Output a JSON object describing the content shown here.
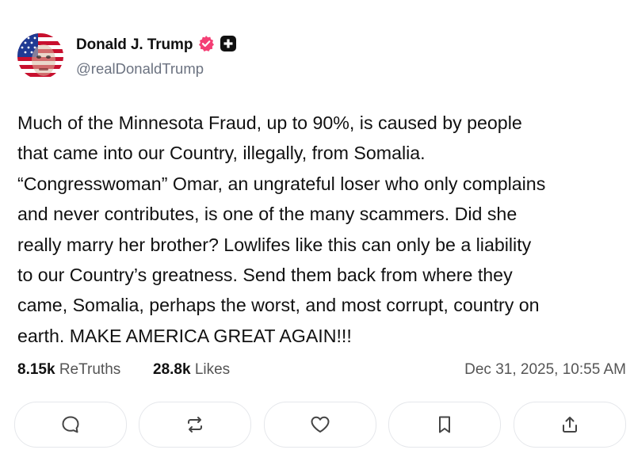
{
  "author": {
    "display_name": "Donald J. Trump",
    "handle": "@realDonaldTrump",
    "verified_badge_color": "#f43f75",
    "avatar_icon": "american-flag-portrait"
  },
  "post": {
    "text": "Much of the Minnesota Fraud, up to 90%, is caused by people\nthat came into our Country, illegally, from Somalia.\n“Congresswoman” Omar, an ungrateful loser who only complains\nand never contributes, is one of the many scammers. Did she\nreally marry her brother? Lowlifes like this can only be a liability\nto our Country’s greatness. Send them back from where they\ncame, Somalia, perhaps the worst, and most corrupt, country on\nearth. MAKE AMERICA GREAT AGAIN!!!"
  },
  "stats": {
    "retruths_count": "8.15k",
    "retruths_label": "ReTruths",
    "likes_count": "28.8k",
    "likes_label": "Likes",
    "timestamp": "Dec 31, 2025, 10:55 AM"
  },
  "actions": [
    {
      "icon": "reply-icon"
    },
    {
      "icon": "retruth-icon"
    },
    {
      "icon": "like-icon"
    },
    {
      "icon": "bookmark-icon"
    },
    {
      "icon": "share-icon"
    }
  ]
}
